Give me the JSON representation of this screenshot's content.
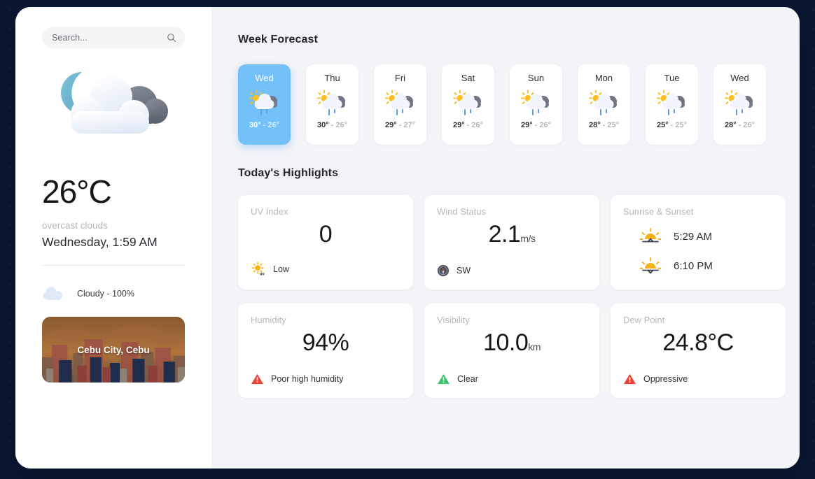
{
  "search": {
    "placeholder": "Search...",
    "value": "",
    "icon": "search-icon"
  },
  "current": {
    "icon": "overcast-clouds-icon",
    "temperature": "26°C",
    "condition": "overcast clouds",
    "datetime": "Wednesday, 1:59 AM",
    "cloudiness": "Cloudy - 100%",
    "cloudiness_icon": "cloud-icon",
    "city": "Cebu City, Cebu"
  },
  "main": {
    "week_title": "Week Forecast",
    "highlights_title": "Today's Highlights"
  },
  "forecast": [
    {
      "day": "Wed",
      "high": "30°",
      "sep": " - ",
      "low": "26°",
      "icon": "sun-cloud-rain-icon",
      "active": true
    },
    {
      "day": "Thu",
      "high": "30°",
      "sep": " - ",
      "low": "26°",
      "icon": "sun-cloud-rain-icon",
      "active": false
    },
    {
      "day": "Fri",
      "high": "29°",
      "sep": " - ",
      "low": "27°",
      "icon": "sun-cloud-rain-icon",
      "active": false
    },
    {
      "day": "Sat",
      "high": "29°",
      "sep": " - ",
      "low": "26°",
      "icon": "sun-cloud-rain-icon",
      "active": false
    },
    {
      "day": "Sun",
      "high": "29°",
      "sep": " - ",
      "low": "26°",
      "icon": "sun-cloud-rain-icon",
      "active": false
    },
    {
      "day": "Mon",
      "high": "28°",
      "sep": " - ",
      "low": "25°",
      "icon": "sun-cloud-rain-icon",
      "active": false
    },
    {
      "day": "Tue",
      "high": "25°",
      "sep": " - ",
      "low": "25°",
      "icon": "sun-cloud-rain-icon",
      "active": false
    },
    {
      "day": "Wed",
      "high": "28°",
      "sep": " - ",
      "low": "26°",
      "icon": "sun-cloud-rain-icon",
      "active": false
    }
  ],
  "highlights": {
    "uv": {
      "label": "UV Index",
      "value": "0",
      "unit": "",
      "status": "Low",
      "status_icon": "uv-sun-icon"
    },
    "wind": {
      "label": "Wind Status",
      "value": "2.1",
      "unit": "m/s",
      "status": "SW",
      "status_icon": "compass-icon"
    },
    "sun": {
      "label": "Sunrise & Sunset",
      "sunrise": "5:29 AM",
      "sunset": "6:10 PM",
      "sunrise_icon": "sunrise-icon",
      "sunset_icon": "sunset-icon"
    },
    "humidity": {
      "label": "Humidity",
      "value": "94%",
      "unit": "",
      "status": "Poor high humidity",
      "status_icon": "warning-triangle-icon"
    },
    "visibility": {
      "label": "Visibility",
      "value": "10.0",
      "unit": "km",
      "status": "Clear",
      "status_icon": "ok-triangle-icon"
    },
    "dewpoint": {
      "label": "Dew Point",
      "value": "24.8°C",
      "unit": "",
      "status": "Oppressive",
      "status_icon": "warning-triangle-icon"
    }
  },
  "colors": {
    "page_background": "#0b1733",
    "app_background": "#f3f4f8",
    "sidebar_background": "#ffffff",
    "accent_blue": "#74c0f8",
    "warning_red": "#ef4136",
    "ok_green": "#3ec46d",
    "sun_yellow": "#fbbf24",
    "muted_text": "#b6b7bd"
  }
}
